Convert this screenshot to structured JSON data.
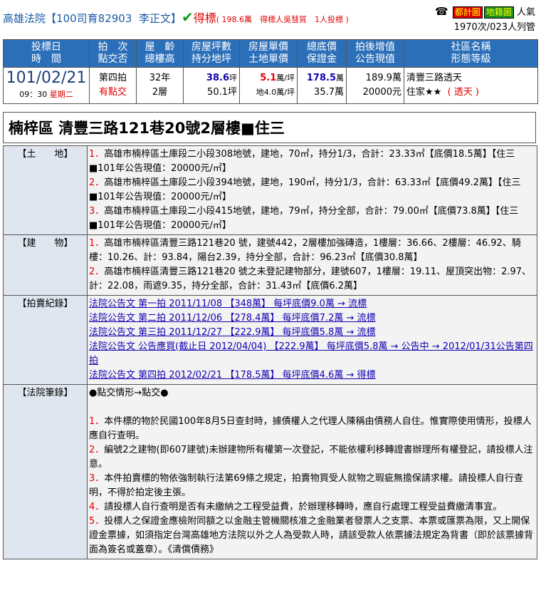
{
  "header": {
    "court": "高雄法院",
    "case_open": "【",
    "case_no": "100司育82903",
    "judge": "李正文",
    "case_close": "】",
    "status": "得標",
    "bid_detail": "( 198.6萬　得標人吳彗質　1人投標 )",
    "phone_icon": "☎",
    "tag_city": "都計圖",
    "tag_land": "地籍圖",
    "popularity_label": "人氣",
    "views": "1970次/023人列管"
  },
  "summary": {
    "headers": [
      [
        "投標日",
        "時　間"
      ],
      [
        "拍　次",
        "點交否"
      ],
      [
        "屋　齡",
        "總樓高"
      ],
      [
        "房屋坪數",
        "持分地坪"
      ],
      [
        "房屋單價",
        "土地單價"
      ],
      [
        "總底價",
        "保證金"
      ],
      [
        "拍後增值",
        "公告現值"
      ],
      [
        "社區名稱",
        "形態等級"
      ]
    ],
    "date": "101/02/21",
    "time": "09：30",
    "weekday": "星期二",
    "round": "第四拍",
    "handover": "有點交",
    "age": "32年",
    "floors": "2層",
    "house_ping": "38.6",
    "house_ping_unit": "坪",
    "land_ping": "50.1坪",
    "house_unit_price": "5.1",
    "house_unit_price_unit": "萬/坪",
    "land_unit_price": "地4.0萬/坪",
    "total_base": "178.5",
    "total_base_unit": "萬",
    "deposit": "35.7萬",
    "appreciation": "189.9萬",
    "announced_value": "20000元",
    "community": "清豐三路透天",
    "grade": "住家★★",
    "grade_type": "( 透天 )"
  },
  "heading": "楠梓區 清豐三路121巷20號2層樓■住三",
  "sections": {
    "land": {
      "label": "【土　　地】",
      "items": [
        {
          "n": "1．",
          "t": "高雄市楠梓區土庫段二小段308地號，建地，70㎡，持分1/3，合計：23.33㎡【底價18.5萬】【住三■101年公告現值：20000元/㎡】"
        },
        {
          "n": "2．",
          "t": "高雄市楠梓區土庫段二小段394地號，建地，190㎡，持分1/3，合計：63.33㎡【底價49.2萬】【住三■101年公告現值：20000元/㎡】"
        },
        {
          "n": "3．",
          "t": "高雄市楠梓區土庫段二小段415地號，建地，79㎡，持分全部，合計：79.00㎡【底價73.8萬】【住三■101年公告現值：20000元/㎡】"
        }
      ]
    },
    "building": {
      "label": "【建　　物】",
      "items": [
        {
          "n": "1．",
          "t": "高雄市楠梓區清豐三路121巷20 號，建號442，2層樓加強磚造，1樓層：36.66、2樓層：46.92、騎樓：10.26、計：93.84，陽台2.39，持分全部，合計：96.23㎡【底價30.8萬】"
        },
        {
          "n": "2．",
          "t": "高雄市楠梓區清豐三路121巷20 號之未登記建物部分，建號607，1樓層：19.11、屋頂突出物：2.97、計：22.08，雨遮9.35，持分全部，合計：31.43㎡【底價6.2萬】"
        }
      ]
    },
    "auction": {
      "label": "【拍賣紀錄】",
      "items": [
        "法院公告文 第一拍 2011/11/08 【348萬】 每坪底價9.0萬 → 流標",
        "法院公告文 第二拍 2011/12/06 【278.4萬】 每坪底價7.2萬 → 流標",
        "法院公告文 第三拍 2011/12/27 【222.9萬】 每坪底價5.8萬 → 流標",
        "法院公告文 公告應買(截止日 2012/04/04) 【222.9萬】 每坪底價5.8萬 → 公告中 → 2012/01/31公告第四拍",
        "法院公告文 第四拍 2012/02/21 【178.5萬】 每坪底價4.6萬 → 得標"
      ]
    },
    "notes": {
      "label": "【法院筆錄】",
      "intro": "●點交情形→點交●",
      "items": [
        {
          "n": "1．",
          "t": "本件標的物於民國100年8月5日查封時，據債權人之代理人陳稱由債務人自住。惟實際使用情形，投標人應自行查明。"
        },
        {
          "n": "2．",
          "t": "編號2之建物(即607建號)未辦建物所有權第一次登記，不能依權利移轉證書辦理所有權登記，請投標人注意。"
        },
        {
          "n": "3．",
          "t": "本件拍賣標的物依強制執行法第69條之規定，拍賣物買受人就物之瑕疵無擔保請求權。請投標人自行查明，不得於拍定後主張。"
        },
        {
          "n": "4．",
          "t": "請投標人自行查明是否有未繳納之工程受益費，於辦理移轉時，應自行處理工程受益費繳清事宜。"
        },
        {
          "n": "5．",
          "t": "投標人之保證金應檢附同額之以金融主管機關核准之金融業者發票人之支票、本票或匯票為限，又上開保證金票據，如須指定台灣高雄地方法院以外之人為受款人時，請該受款人依票據法規定為背書（即於該票據背面為簽名或蓋章）。《清償債務》"
        }
      ]
    }
  }
}
